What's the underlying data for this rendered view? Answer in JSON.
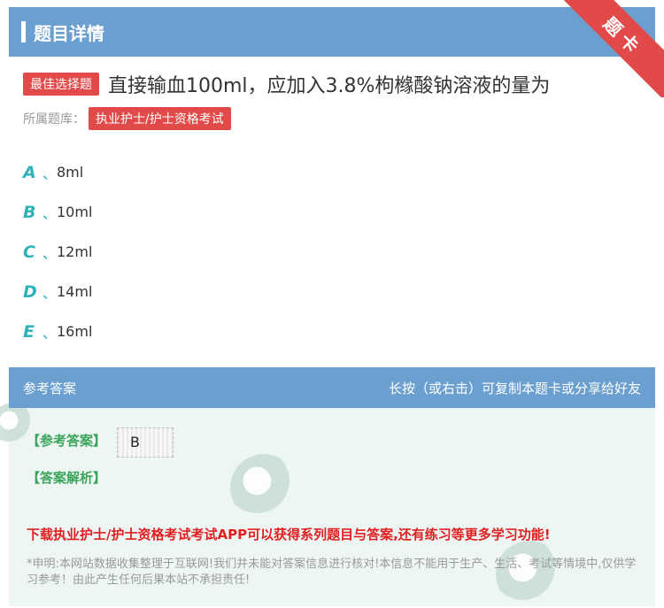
{
  "header": {
    "title": "题目详情",
    "corner_badge": "题卡"
  },
  "question": {
    "type_badge": "最佳选择题",
    "text": "直接输血100ml，应加入3.8%枸橼酸钠溶液的量为",
    "bank_label": "所属题库：",
    "bank_tag": "执业护士/护士资格考试"
  },
  "options": [
    {
      "letter": "A",
      "sep": "、",
      "text": "8ml"
    },
    {
      "letter": "B",
      "sep": "、",
      "text": "10ml"
    },
    {
      "letter": "C",
      "sep": "、",
      "text": "12ml"
    },
    {
      "letter": "D",
      "sep": "、",
      "text": "14ml"
    },
    {
      "letter": "E",
      "sep": "、",
      "text": "16ml"
    }
  ],
  "answer": {
    "header_left": "参考答案",
    "header_right": "长按（或右击）可复制本题卡或分享给好友",
    "answer_label": "【参考答案】",
    "answer_value": "B",
    "analysis_label": "【答案解析】",
    "promo": "下载执业护士/护士资格考试考试APP可以获得系列题目与答案,还有练习等更多学习功能!",
    "disclaimer": "*申明:本网站数据收集整理于互联网!我们并未能对答案信息进行核对!本信息不能用于生产、生活、考试等情境中,仅供学习参考！由此产生任何后果本站不承担责任!"
  },
  "colors": {
    "header_blue": "#6a9fd0",
    "badge_red": "#e24a4a",
    "option_teal": "#2fb3b8",
    "answer_green": "#3aa55a",
    "promo_red": "#e02020"
  }
}
